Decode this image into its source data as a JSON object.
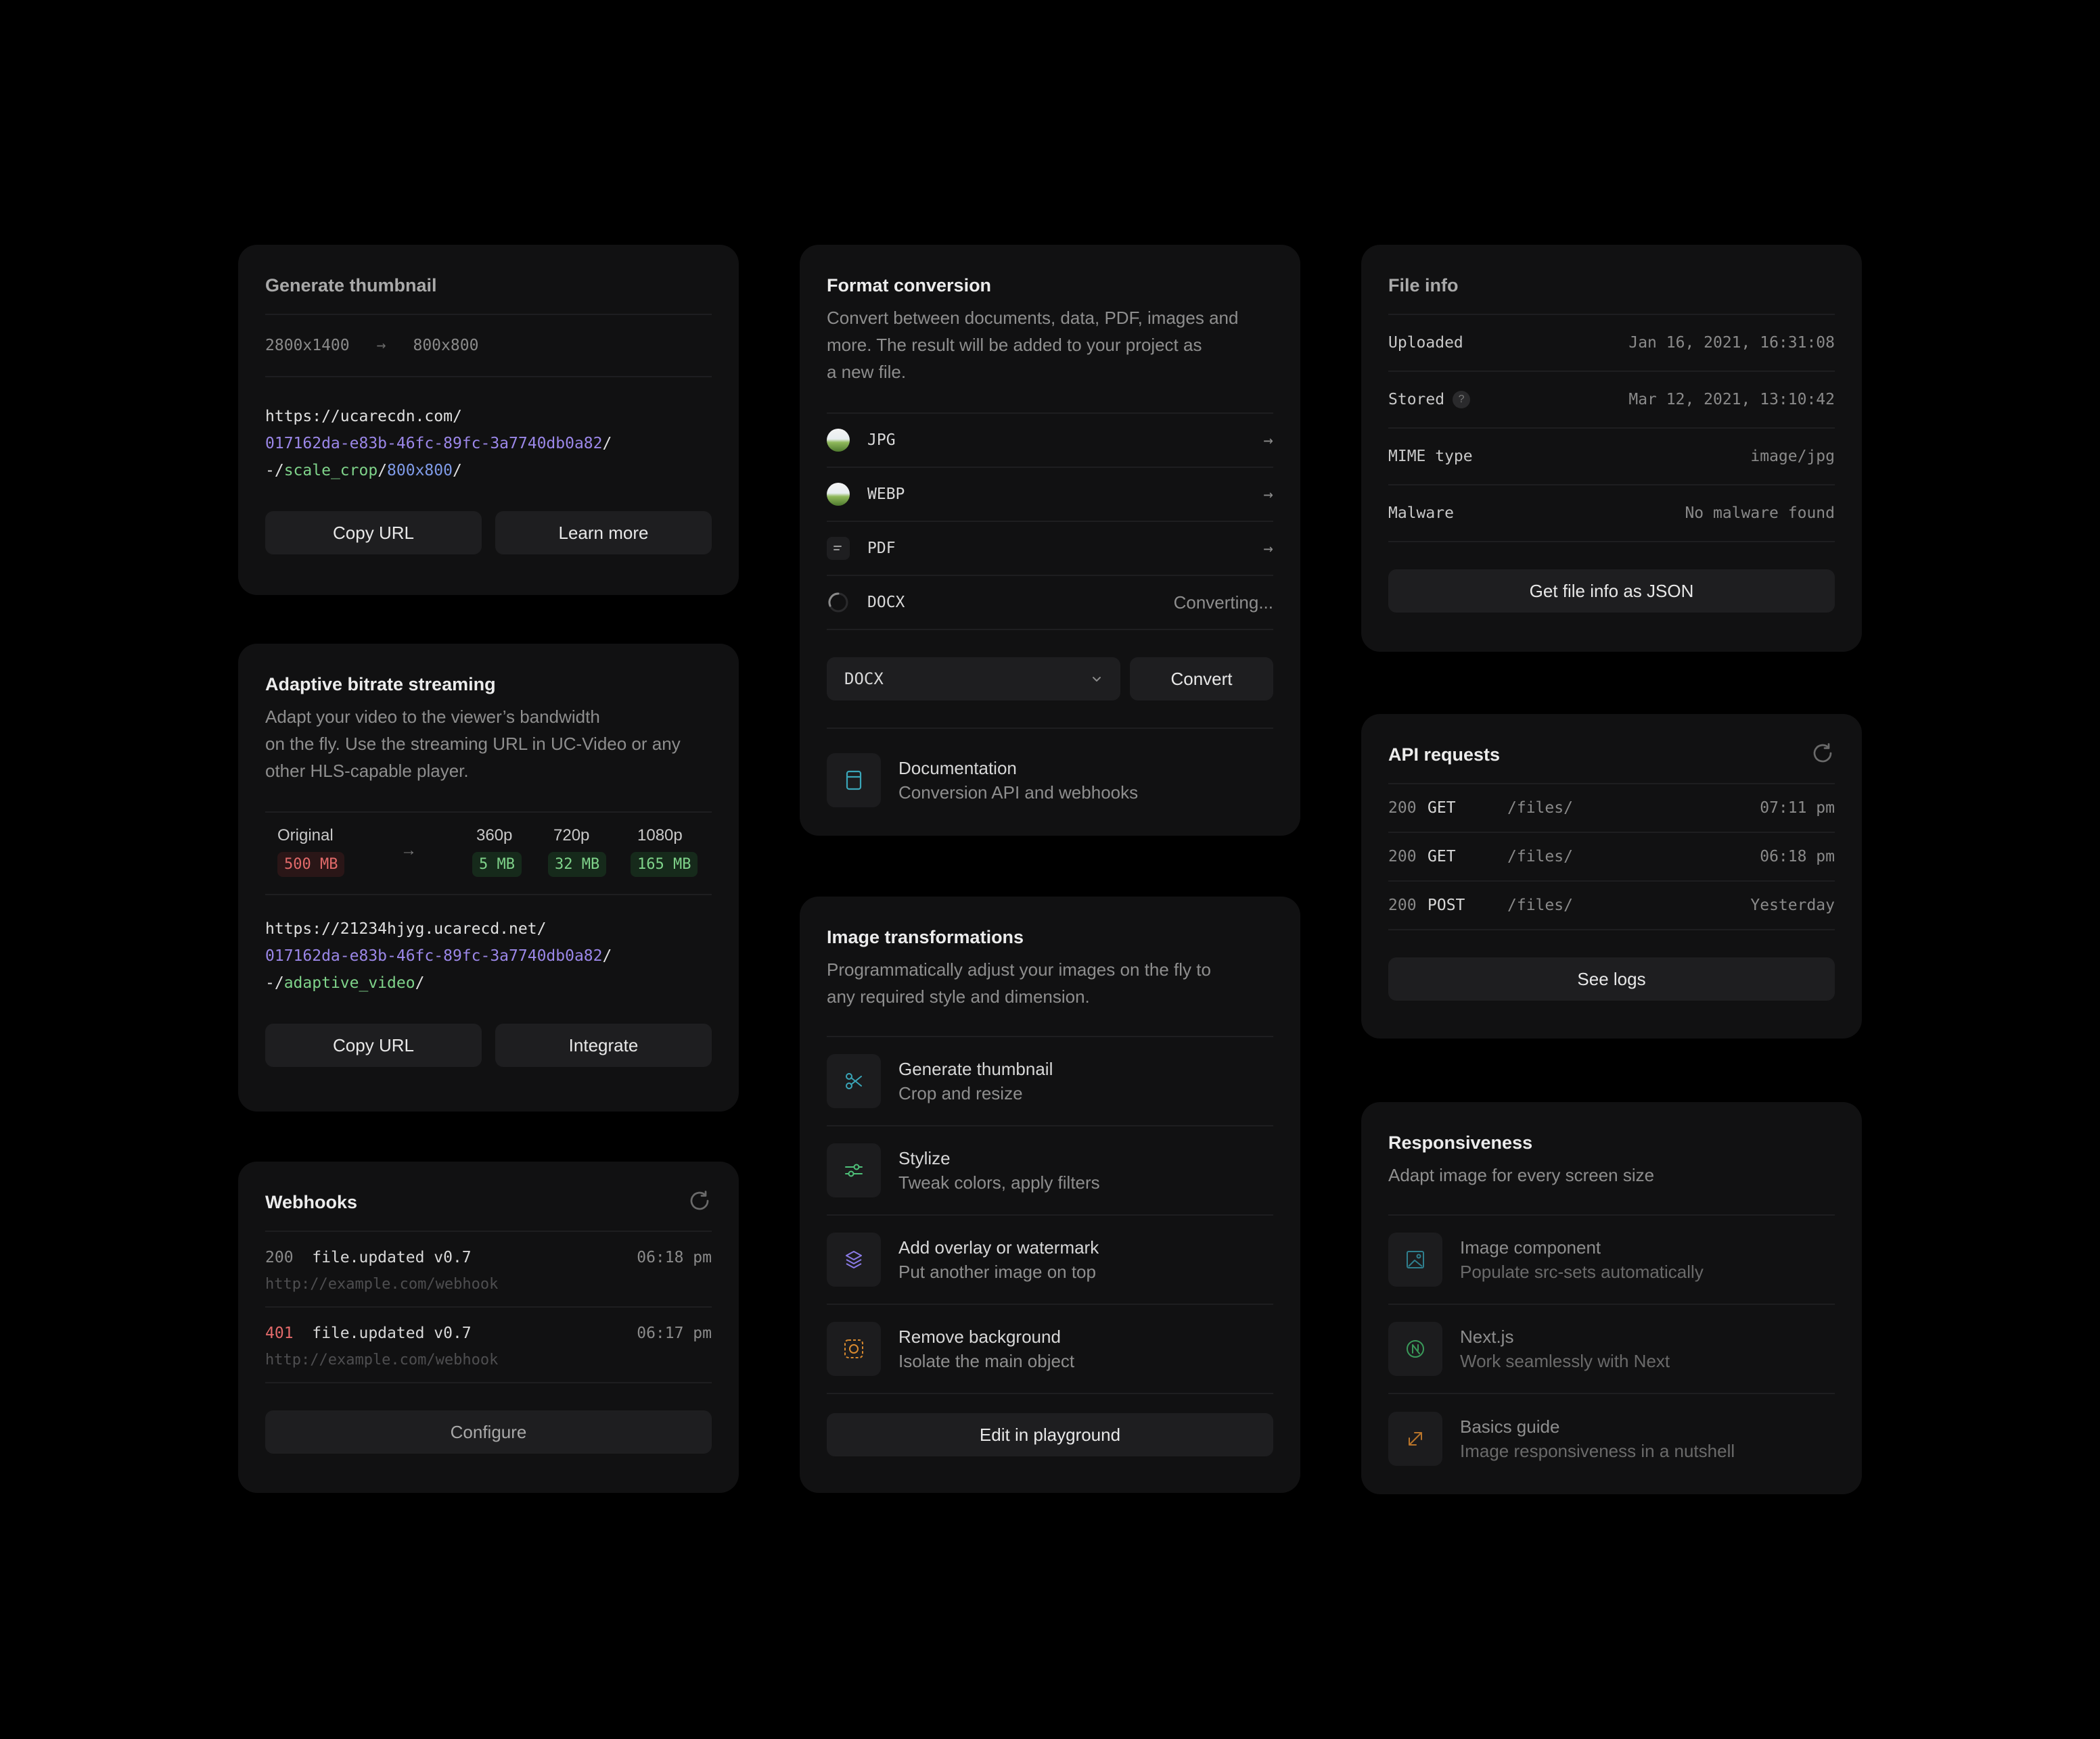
{
  "generate_thumbnail": {
    "title": "Generate thumbnail",
    "size_from": "2800x1400",
    "size_to": "800x800",
    "url_line1": "https://ucarecdn.com/",
    "url_uuid": "017162da-e83b-46fc-89fc-3a7740db0a82",
    "url_slash": "/",
    "url_prefix": "-/",
    "url_op": "scale_crop",
    "url_sep": "/",
    "url_arg": "800x800",
    "url_end": "/",
    "copy_label": "Copy URL",
    "learn_label": "Learn more"
  },
  "adaptive": {
    "title": "Adaptive bitrate streaming",
    "desc1": "Adapt your video to the viewer’s bandwidth",
    "desc2": "on the fly. Use the streaming URL in UC-Video or any",
    "desc3": "other HLS-capable player.",
    "original_label": "Original",
    "original_size": "500 MB",
    "variants": [
      {
        "label": "360p",
        "size": "5 MB"
      },
      {
        "label": "720p",
        "size": "32 MB"
      },
      {
        "label": "1080p",
        "size": "165 MB"
      }
    ],
    "url_line1": "https://21234hjyg.ucarecd.net/",
    "url_uuid": "017162da-e83b-46fc-89fc-3a7740db0a82",
    "url_slash": "/",
    "url_prefix": "-/",
    "url_op": "adaptive_video",
    "url_end": "/",
    "copy_label": "Copy URL",
    "integrate_label": "Integrate"
  },
  "webhooks": {
    "title": "Webhooks",
    "items": [
      {
        "code": "200",
        "event": "file.updated v0.7",
        "time": "06:18 pm",
        "url": "http://example.com/webhook"
      },
      {
        "code": "401",
        "event": "file.updated v0.7",
        "time": "06:17 pm",
        "url": "http://example.com/webhook"
      }
    ],
    "configure_label": "Configure"
  },
  "format_conversion": {
    "title": "Format conversion",
    "desc1": "Convert between documents, data, PDF, images and",
    "desc2": "more. The result will be added to your project as",
    "desc3": "a new file.",
    "formats": [
      {
        "label": "JPG",
        "status": ""
      },
      {
        "label": "WEBP",
        "status": ""
      },
      {
        "label": "PDF",
        "status": ""
      },
      {
        "label": "DOCX",
        "status": "Converting..."
      }
    ],
    "select_value": "DOCX",
    "convert_label": "Convert",
    "doc_title": "Documentation",
    "doc_sub": "Conversion API and webhooks"
  },
  "image_transformations": {
    "title": "Image transformations",
    "desc1": "Programmatically adjust your images on the fly to",
    "desc2": "any required style and dimension.",
    "items": [
      {
        "title": "Generate thumbnail",
        "sub": "Crop and resize",
        "icon": "scissors-icon"
      },
      {
        "title": "Stylize",
        "sub": "Tweak colors, apply filters",
        "icon": "sliders-icon"
      },
      {
        "title": "Add overlay or watermark",
        "sub": "Put another image on top",
        "icon": "layers-icon"
      },
      {
        "title": "Remove background",
        "sub": "Isolate the main object",
        "icon": "background-remove-icon"
      }
    ],
    "playground_label": "Edit in playground"
  },
  "file_info": {
    "title": "File info",
    "rows": [
      {
        "key": "Uploaded",
        "value": "Jan 16, 2021, 16:31:08"
      },
      {
        "key": "Stored",
        "value": "Mar 12, 2021, 13:10:42"
      },
      {
        "key": "MIME type",
        "value": "image/jpg"
      },
      {
        "key": "Malware",
        "value": "No malware found"
      }
    ],
    "help_glyph": "?",
    "json_label": "Get file info as JSON"
  },
  "api_requests": {
    "title": "API requests",
    "rows": [
      {
        "code": "200",
        "method": "GET",
        "path": "/files/",
        "time": "07:11 pm"
      },
      {
        "code": "200",
        "method": "GET",
        "path": "/files/",
        "time": "06:18 pm"
      },
      {
        "code": "200",
        "method": "POST",
        "path": "/files/",
        "time": "Yesterday"
      }
    ],
    "logs_label": "See logs"
  },
  "responsiveness": {
    "title": "Responsiveness",
    "desc": "Adapt image for every screen size",
    "items": [
      {
        "title": "Image component",
        "sub": "Populate src-sets automatically",
        "icon": "image-icon"
      },
      {
        "title": "Next.js",
        "sub": "Work seamlessly with Next",
        "icon": "nextjs-icon"
      },
      {
        "title": "Basics guide",
        "sub": "Image responsiveness in a nutshell",
        "icon": "expand-arrow-icon"
      }
    ]
  },
  "colors": {
    "background": "#000000",
    "card": "#111112",
    "button": "#1e1e20",
    "error_red": "#e26a6a",
    "success_green": "#7fd38a",
    "uuid_purple": "#9b87e8"
  }
}
